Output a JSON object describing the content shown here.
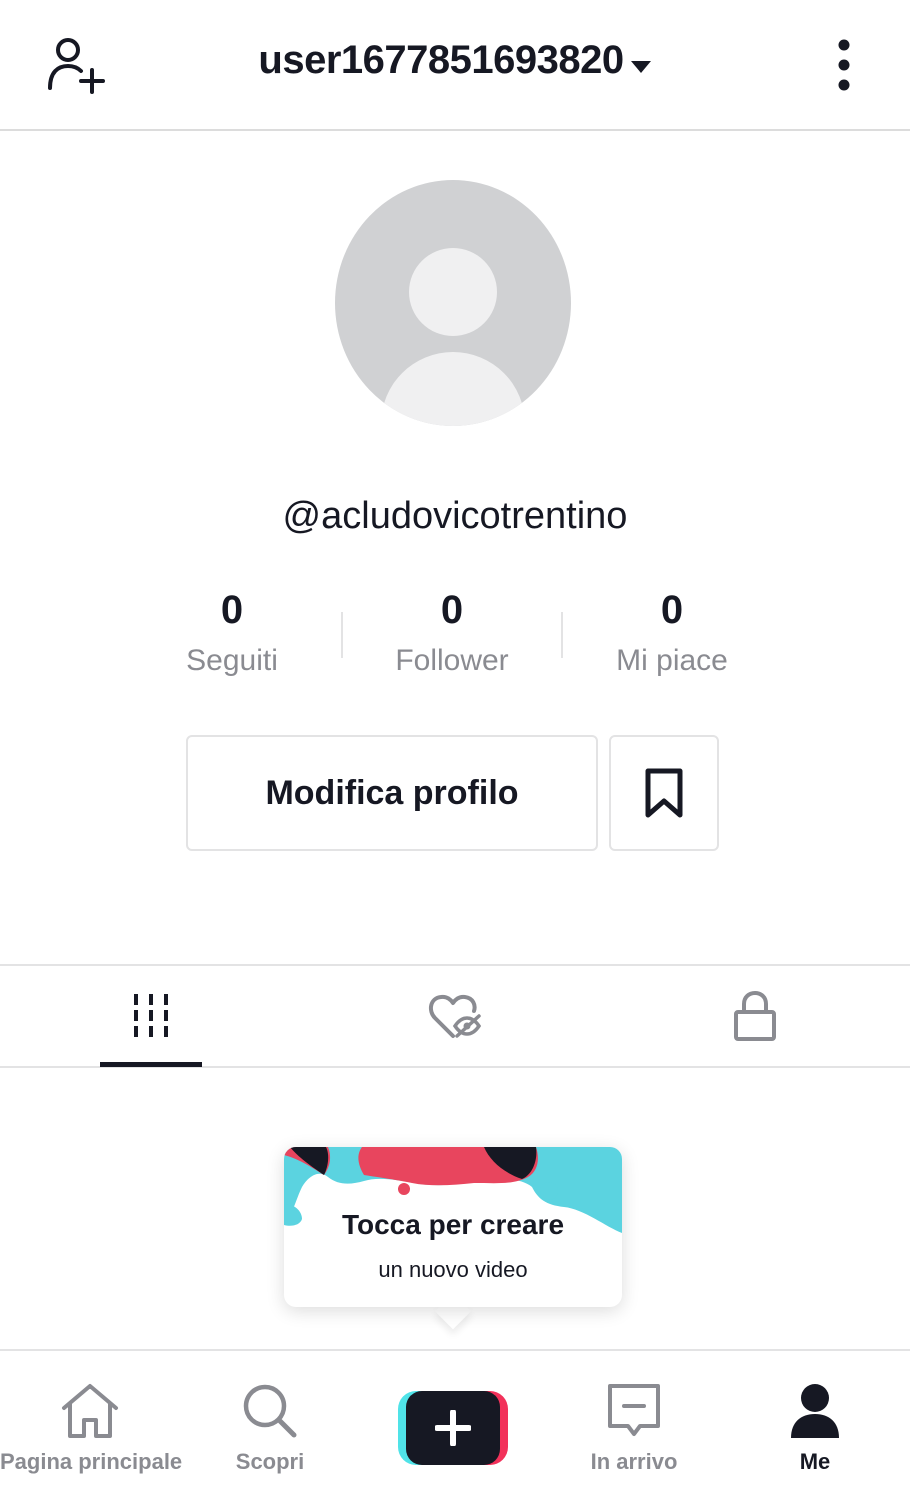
{
  "header": {
    "username": "user1677851693820"
  },
  "profile": {
    "handle": "@acludovicotrentino",
    "stats": [
      {
        "value": "0",
        "label": "Seguiti"
      },
      {
        "value": "0",
        "label": "Follower"
      },
      {
        "value": "0",
        "label": "Mi piace"
      }
    ],
    "edit_button": "Modifica profilo"
  },
  "tabs": [
    {
      "icon": "grid-icon",
      "active": true
    },
    {
      "icon": "liked-hidden-icon",
      "active": false
    },
    {
      "icon": "lock-icon",
      "active": false
    }
  ],
  "tooltip": {
    "line1": "Tocca per creare",
    "line2": "un nuovo video"
  },
  "bottom_nav": [
    {
      "label": "Pagina principale",
      "icon": "home-icon",
      "active": false
    },
    {
      "label": "Scopri",
      "icon": "search-icon",
      "active": false
    },
    {
      "label": "",
      "icon": "plus-icon",
      "active": false
    },
    {
      "label": "In arrivo",
      "icon": "inbox-icon",
      "active": false
    },
    {
      "label": "Me",
      "icon": "profile-icon",
      "active": true
    }
  ],
  "colors": {
    "text": "#161823",
    "secondary_text": "#8a8b91",
    "divider": "#e3e3e4",
    "accent_cyan": "#50e3e8",
    "accent_red": "#f2315a"
  }
}
